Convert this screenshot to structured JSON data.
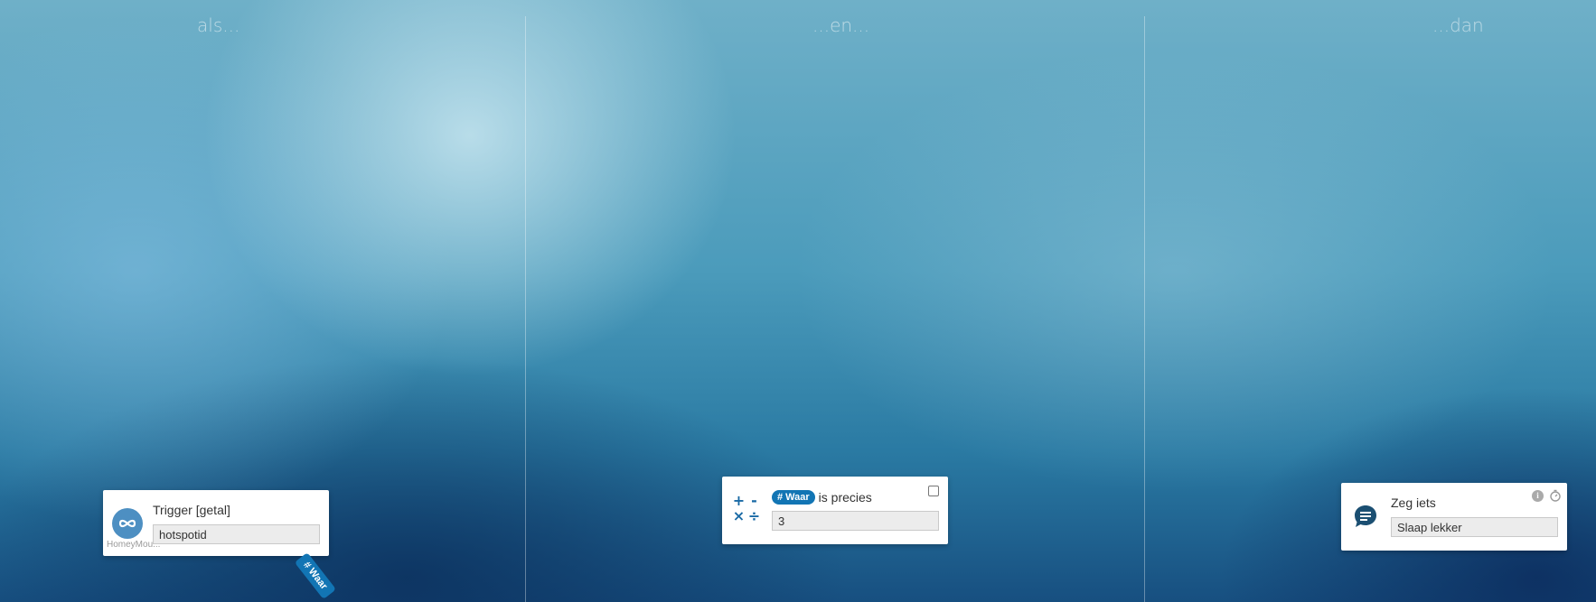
{
  "columns": {
    "when": "als...",
    "and": "...en...",
    "then": "...dan"
  },
  "trigger_card": {
    "title": "Trigger [getal]",
    "field_value": "hotspotid",
    "app_caption": "HomeyMou...",
    "token_label": "# Waar",
    "icon": "infinity-icon"
  },
  "condition_card": {
    "token_label": "# Waar",
    "title_suffix": "is precies",
    "field_value": "3",
    "icon": "math-operators-icon",
    "operators": [
      "+",
      "-",
      "×",
      "÷"
    ]
  },
  "action_card": {
    "title": "Zeg iets",
    "field_value": "Slaap lekker",
    "icon": "speech-bubble-icon",
    "info_icon": "info-icon",
    "timer_icon": "timer-icon"
  },
  "colors": {
    "token": "#1275b4",
    "accent": "#1a6aa5",
    "app_icon": "#4d8fc2"
  }
}
